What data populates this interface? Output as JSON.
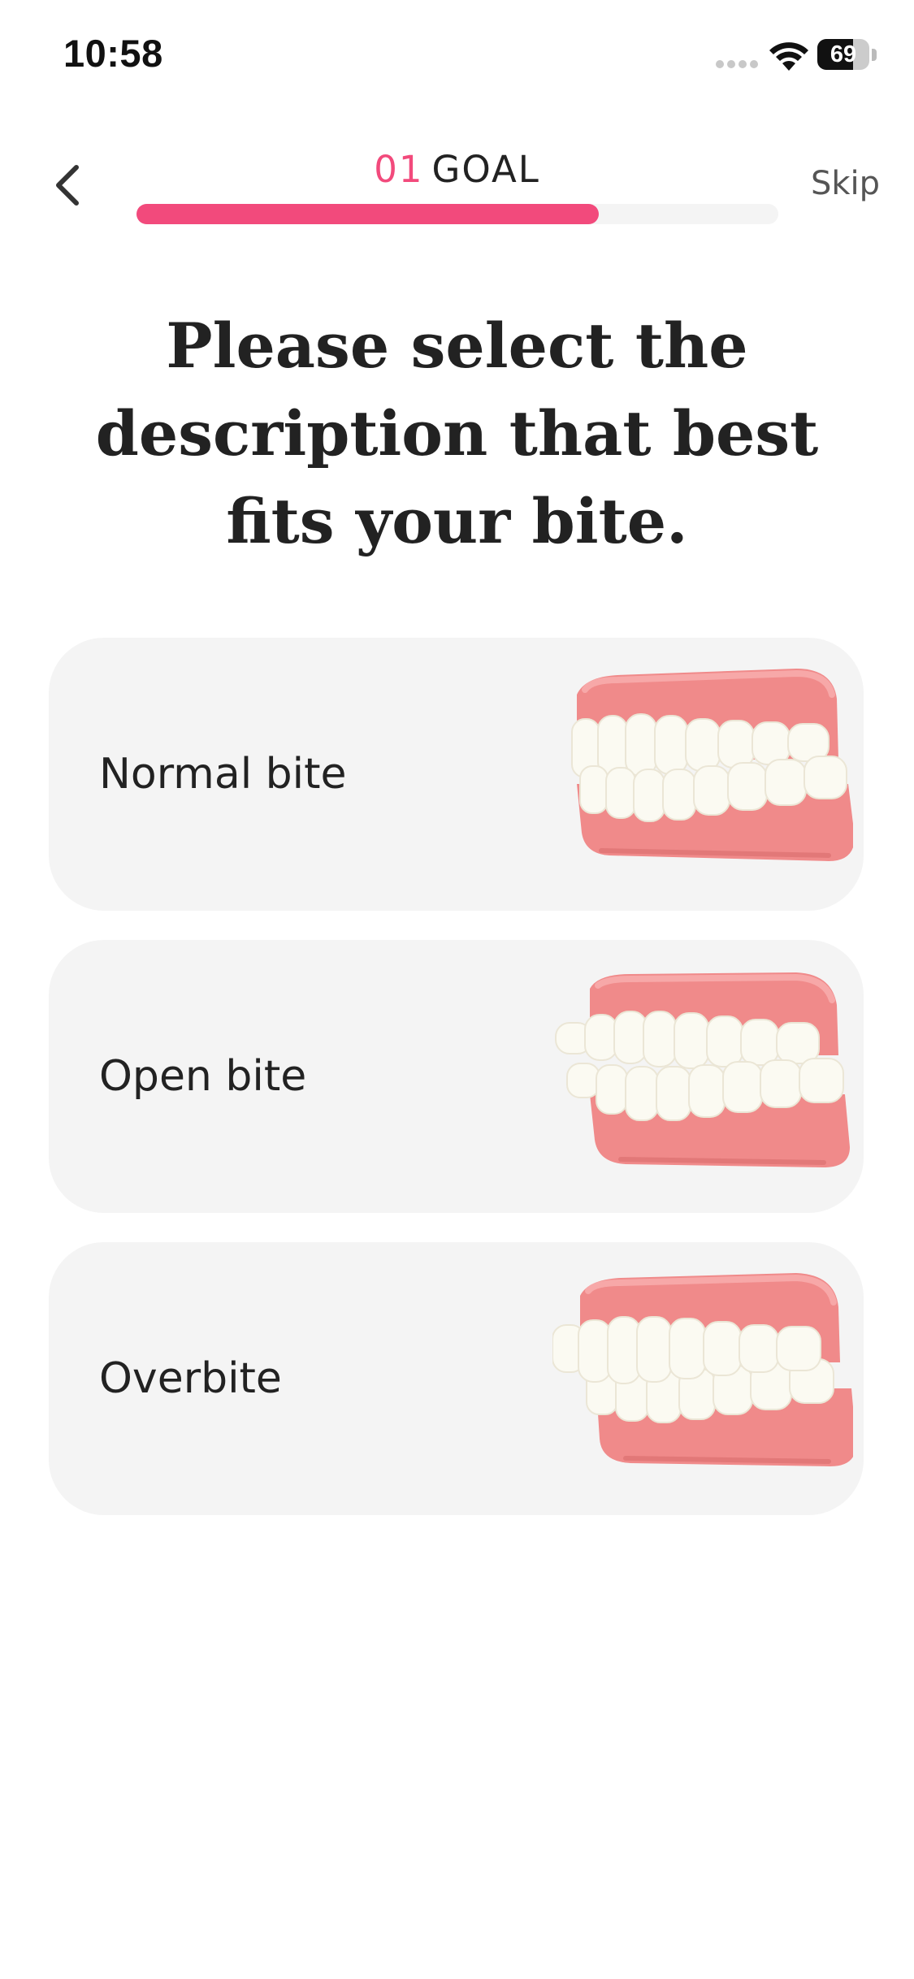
{
  "status_bar": {
    "time": "10:58",
    "battery_percent": 69,
    "battery_text": "69"
  },
  "header": {
    "step_number": "01",
    "step_name": "GOAL",
    "skip_label": "Skip",
    "progress": 0.72,
    "icons": {
      "back": "chevron-left-icon"
    }
  },
  "question": {
    "title": "Please select the description that best fits your bite."
  },
  "options": [
    {
      "label": "Normal bite",
      "icon": "normal-bite-teeth-icon"
    },
    {
      "label": "Open bite",
      "icon": "open-bite-teeth-icon"
    },
    {
      "label": "Overbite",
      "icon": "overbite-teeth-icon"
    }
  ],
  "colors": {
    "accent": "#f24a7c",
    "card_background": "#f4f4f4",
    "gum": "#f08a8a",
    "tooth": "#fbfaf2"
  }
}
